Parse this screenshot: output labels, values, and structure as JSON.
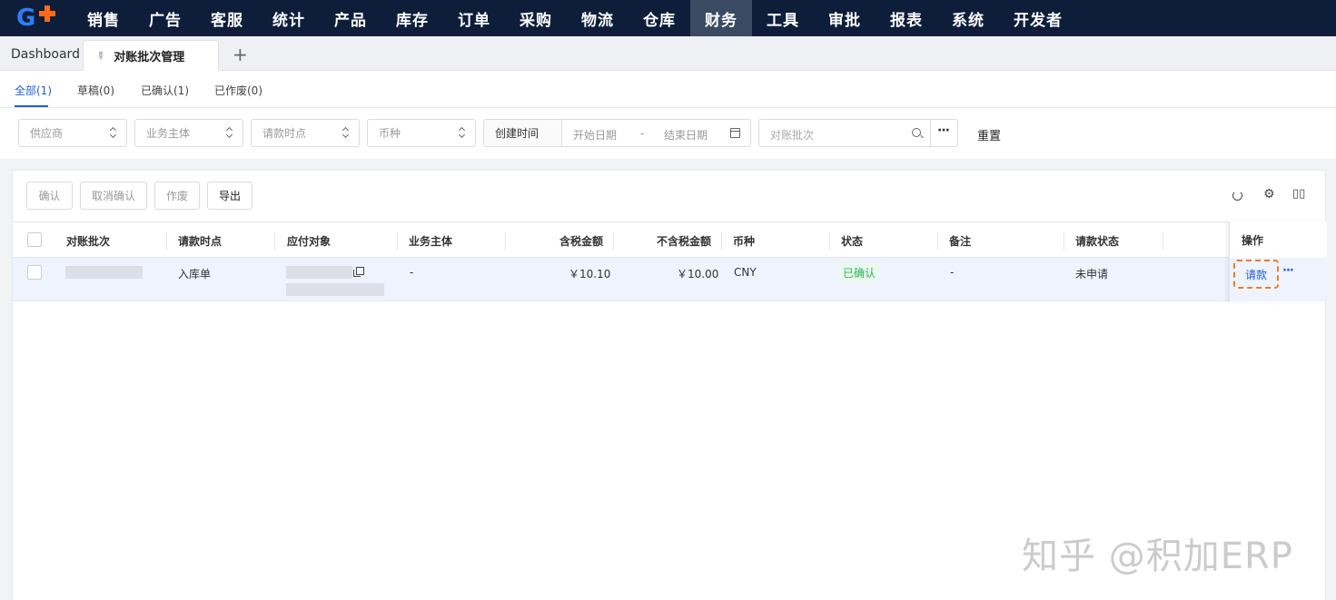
{
  "nav": {
    "items": [
      "销售",
      "广告",
      "客服",
      "统计",
      "产品",
      "库存",
      "订单",
      "采购",
      "物流",
      "仓库",
      "财务",
      "工具",
      "审批",
      "报表",
      "系统",
      "开发者"
    ],
    "active": "财务"
  },
  "tabs": {
    "dashboard": "Dashboard",
    "active": "对账批次管理",
    "add": "+"
  },
  "status_tabs": [
    "全部(1)",
    "草稿(0)",
    "已确认(1)",
    "已作废(0)"
  ],
  "filters": {
    "supplier": "供应商",
    "entity": "业务主体",
    "request_point": "请款时点",
    "currency": "币种",
    "date_label": "创建时间",
    "start_date": "开始日期",
    "date_sep": "-",
    "end_date": "结束日期",
    "batch_search": "对账批次",
    "more": "···",
    "reset": "重置"
  },
  "actions": {
    "confirm": "确认",
    "cancel_confirm": "取消确认",
    "void": "作废",
    "export": "导出"
  },
  "table": {
    "headers": {
      "batch": "对账批次",
      "request_point": "请款时点",
      "payee": "应付对象",
      "entity": "业务主体",
      "tax_incl": "含税金额",
      "tax_excl": "不含税金额",
      "currency": "币种",
      "status": "状态",
      "remark": "备注",
      "request_status": "请款状态",
      "ops": "操作"
    },
    "row": {
      "request_point": "入库单",
      "entity": "-",
      "tax_incl": "￥10.10",
      "tax_excl": "￥10.00",
      "currency": "CNY",
      "status": "已确认",
      "remark": "-",
      "request_status": "未申请",
      "op_request": "请款",
      "op_more": "···"
    }
  },
  "watermark": "知乎 @积加ERP",
  "colors": {
    "nav_bg": "#0e1e3a",
    "accent": "#1f5fd6",
    "success": "#2fb35a",
    "highlight": "#f07b24",
    "row_bg": "#eef3fd"
  }
}
